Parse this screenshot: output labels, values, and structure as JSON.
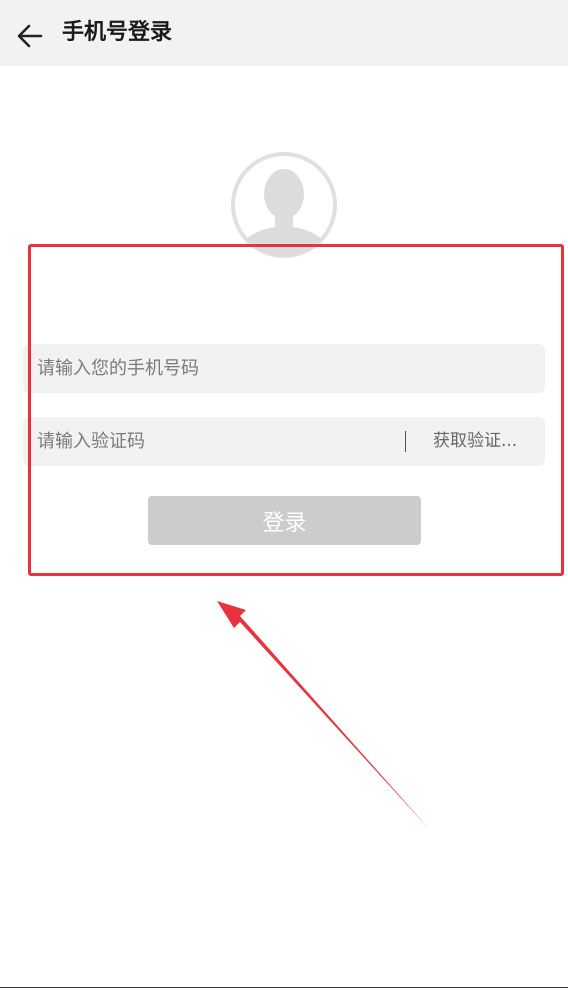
{
  "header": {
    "title": "手机号登录",
    "back_icon": "arrow-left-icon"
  },
  "avatar": {
    "icon": "default-avatar-icon"
  },
  "form": {
    "phone_placeholder": "请输入您的手机号码",
    "phone_value": "",
    "code_placeholder": "请输入验证码",
    "code_value": "",
    "get_code_label": "获取验证...",
    "login_label": "登录"
  },
  "colors": {
    "header_bg": "#f2f2f2",
    "field_bg": "#f2f2f2",
    "login_button_disabled": "#cccccc",
    "annotation_red": "#e8323c"
  }
}
